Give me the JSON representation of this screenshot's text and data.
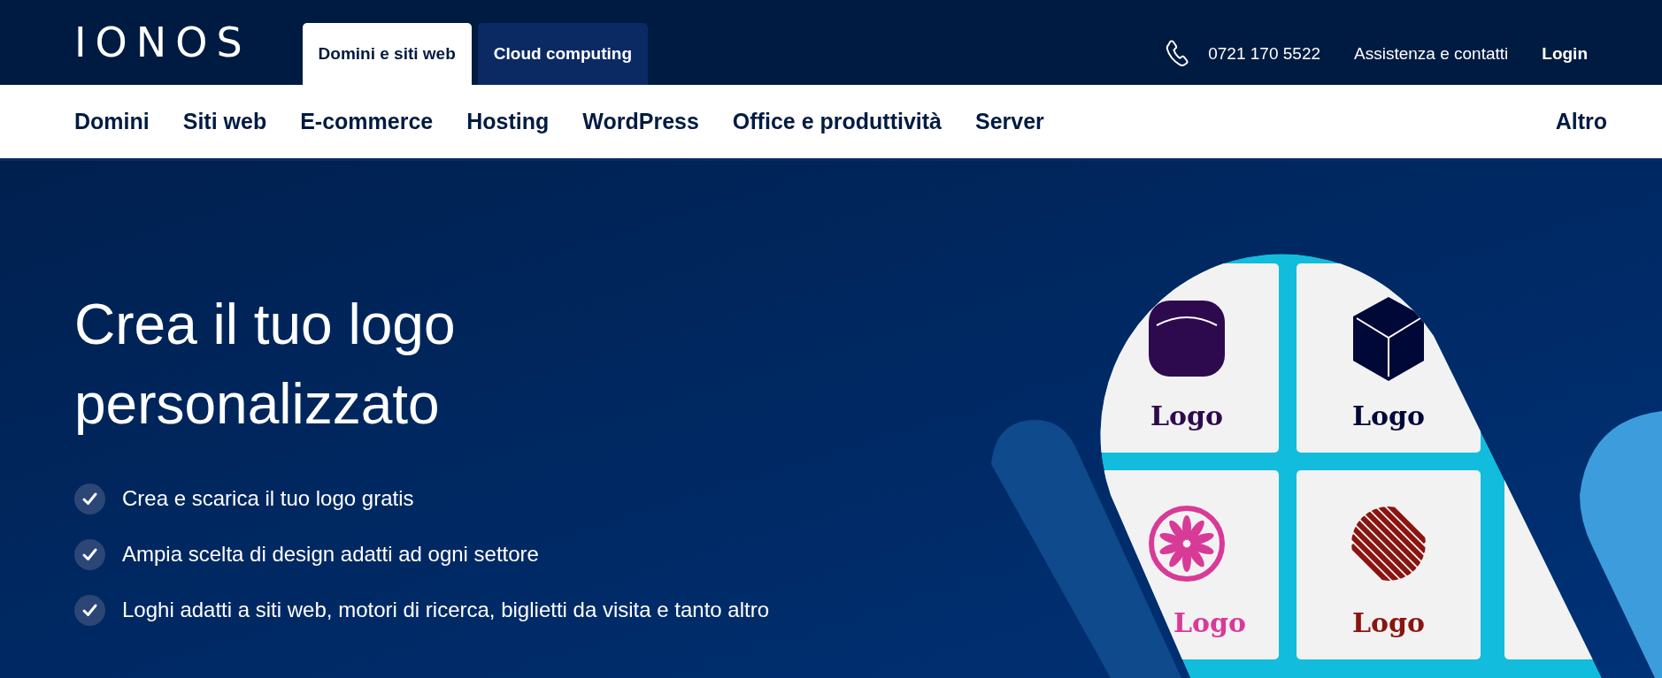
{
  "header": {
    "logo": "IONOS",
    "tabs": [
      {
        "label": "Domini e siti web",
        "selected": true
      },
      {
        "label": "Cloud computing",
        "selected": false
      }
    ],
    "phone": "0721 170 5522",
    "support": "Assistenza e contatti",
    "login": "Login"
  },
  "nav": {
    "items": [
      "Domini",
      "Siti web",
      "E-commerce",
      "Hosting",
      "WordPress",
      "Office e produttività",
      "Server"
    ],
    "more": "Altro"
  },
  "hero": {
    "title_lines": [
      "Crea il tuo logo",
      "personalizzato"
    ],
    "bullets": [
      "Crea e scarica il tuo logo gratis",
      "Ampia scelta di design adatti ad ogni settore",
      "Loghi adatti a siti web, motori di ricerca, biglietti da visita e tanto altro"
    ],
    "illustration": {
      "tiles": [
        {
          "kind": "rounded-square",
          "label": "Logo",
          "color": "#2d0a4e"
        },
        {
          "kind": "cube",
          "label": "Logo",
          "color": "#000838"
        },
        {
          "kind": "flower",
          "label": "Logo",
          "color": "#d83a98"
        },
        {
          "kind": "weave",
          "label": "Logo",
          "color": "#8a1410"
        }
      ]
    }
  }
}
